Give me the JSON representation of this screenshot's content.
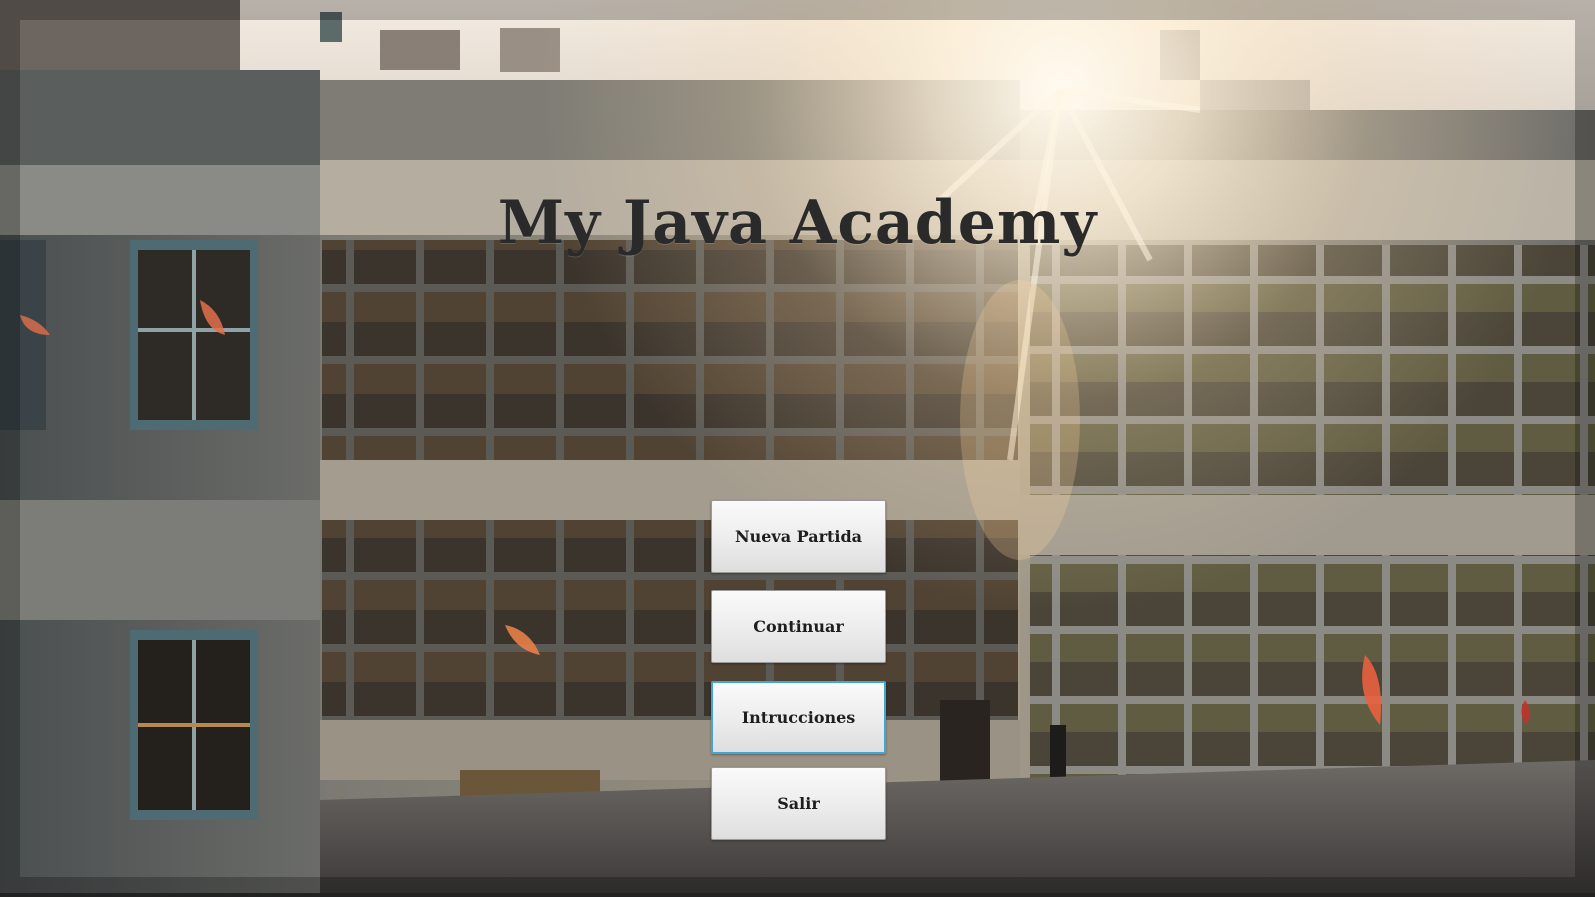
{
  "title": "My Java Academy",
  "menu": {
    "items": [
      {
        "label": "Nueva Partida",
        "focused": false
      },
      {
        "label": "Continuar",
        "focused": false
      },
      {
        "label": "Intrucciones",
        "focused": true
      },
      {
        "label": "Salir",
        "focused": false
      }
    ]
  },
  "colors": {
    "title_text": "#2a2a2a",
    "button_face": "#ececec",
    "button_focus_border": "#3fa6d6"
  },
  "background": {
    "icon": "school-building-sunset-image"
  }
}
